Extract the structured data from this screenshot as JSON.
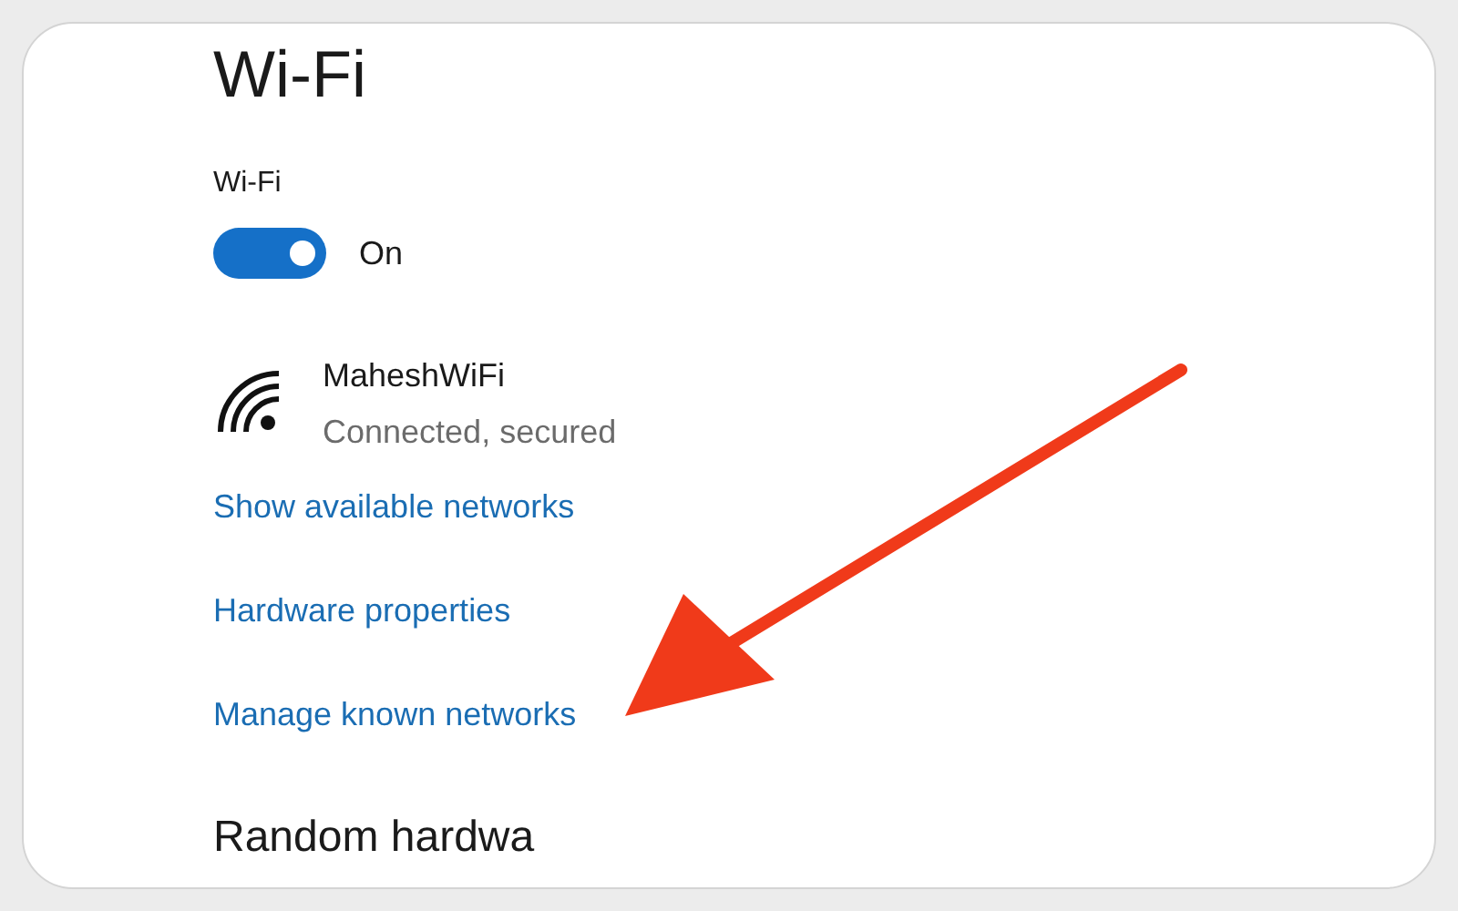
{
  "page_title": "Wi-Fi",
  "wifi_toggle": {
    "label": "Wi-Fi",
    "on": true,
    "state_text": "On"
  },
  "network": {
    "name": "MaheshWiFi",
    "status": "Connected, secured"
  },
  "links": [
    "Show available networks",
    "Hardware properties",
    "Manage known networks"
  ],
  "section_heading": "Random hardwa"
}
